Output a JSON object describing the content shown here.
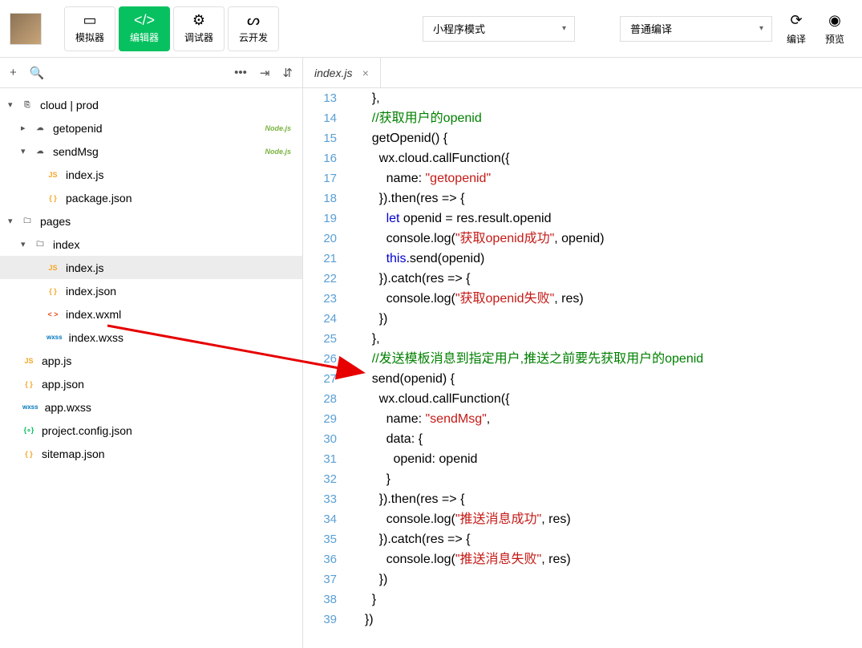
{
  "toolbar": {
    "simulator": "模拟器",
    "editor": "编辑器",
    "debugger": "调试器",
    "cloud": "云开发",
    "mode": "小程序模式",
    "compile_mode": "普通编译",
    "compile": "编译",
    "preview": "预览"
  },
  "tree": {
    "root": "cloud | prod",
    "getopenid": "getopenid",
    "sendMsg": "sendMsg",
    "index_js": "index.js",
    "package_json": "package.json",
    "pages": "pages",
    "index_folder": "index",
    "index_js2": "index.js",
    "index_json": "index.json",
    "index_wxml": "index.wxml",
    "index_wxss": "index.wxss",
    "app_js": "app.js",
    "app_json": "app.json",
    "app_wxss": "app.wxss",
    "project_config": "project.config.json",
    "sitemap": "sitemap.json",
    "nodejs": "Node.js"
  },
  "tab": {
    "name": "index.js"
  },
  "code": {
    "lines": [
      13,
      14,
      15,
      16,
      17,
      18,
      19,
      20,
      21,
      22,
      23,
      24,
      25,
      26,
      27,
      28,
      29,
      30,
      31,
      32,
      33,
      34,
      35,
      36,
      37,
      38,
      39
    ],
    "l13": "    },",
    "l14_c": "    //获取用户的openid",
    "l15": "    getOpenid() {",
    "l16": "      wx.cloud.callFunction({",
    "l17a": "        name: ",
    "l17s": "\"getopenid\"",
    "l18": "      }).then(res => {",
    "l19a": "        ",
    "l19k": "let",
    "l19b": " openid = res.result.openid",
    "l20a": "        console.log(",
    "l20s": "\"获取openid成功\"",
    "l20b": ", openid)",
    "l21a": "        ",
    "l21k": "this",
    "l21b": ".send(openid)",
    "l22": "      }).catch(res => {",
    "l23a": "        console.log(",
    "l23s": "\"获取openid失败\"",
    "l23b": ", res)",
    "l24": "      })",
    "l25": "    },",
    "l26_c": "    //发送模板消息到指定用户,推送之前要先获取用户的openid",
    "l27": "    send(openid) {",
    "l28": "      wx.cloud.callFunction({",
    "l29a": "        name: ",
    "l29s": "\"sendMsg\"",
    "l29b": ",",
    "l30": "        data: {",
    "l31": "          openid: openid",
    "l32": "        }",
    "l33": "      }).then(res => {",
    "l34a": "        console.log(",
    "l34s": "\"推送消息成功\"",
    "l34b": ", res)",
    "l35": "      }).catch(res => {",
    "l36a": "        console.log(",
    "l36s": "\"推送消息失败\"",
    "l36b": ", res)",
    "l37": "      })",
    "l38": "    }",
    "l39": "  })"
  }
}
